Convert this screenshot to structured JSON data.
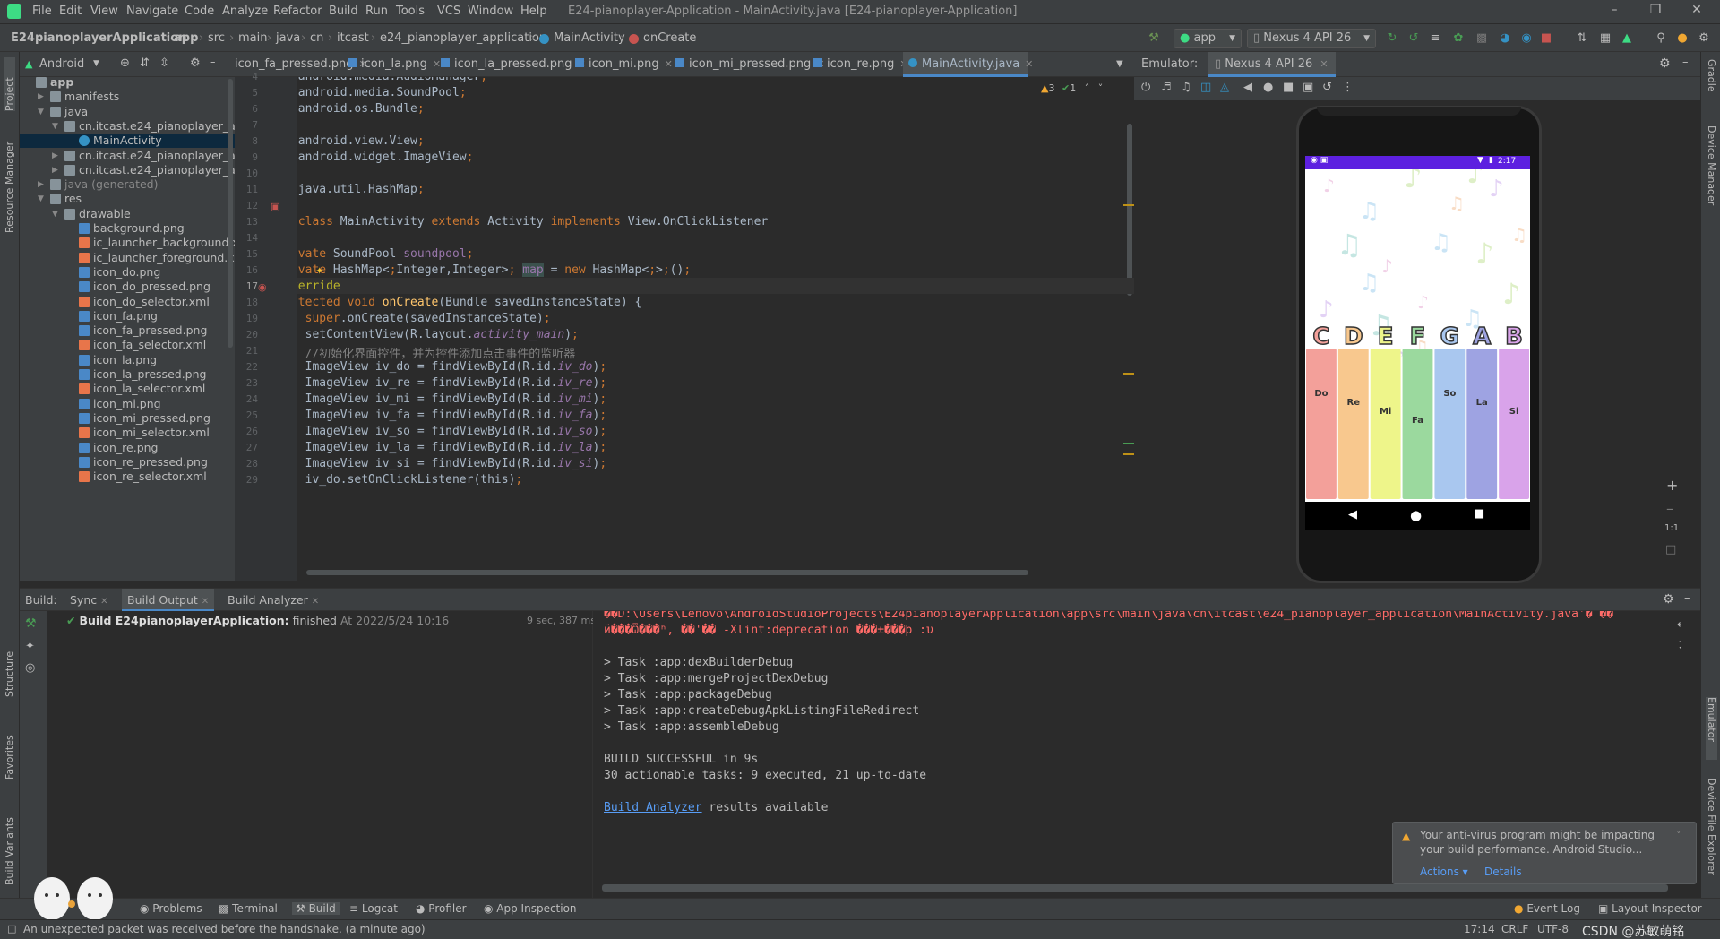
{
  "menu": {
    "items": [
      "File",
      "Edit",
      "View",
      "Navigate",
      "Code",
      "Analyze",
      "Refactor",
      "Build",
      "Run",
      "Tools",
      "VCS",
      "Window",
      "Help"
    ],
    "window_title": "E24-pianoplayer-Application - MainActivity.java [E24-pianoplayer-Application]"
  },
  "breadcrumb": [
    "E24pianoplayerApplication",
    "app",
    "src",
    "main",
    "java",
    "cn",
    "itcast",
    "e24_pianoplayer_application",
    "MainActivity",
    "onCreate"
  ],
  "run_config": {
    "module": "app",
    "device": "Nexus 4 API 26"
  },
  "project_panel": {
    "view_label": "Android",
    "tree": [
      {
        "label": "app",
        "level": 0
      },
      {
        "label": "manifests",
        "level": 1
      },
      {
        "label": "java",
        "level": 1
      },
      {
        "label": "cn.itcast.e24_pianoplayer_applic",
        "level": 2
      },
      {
        "label": "MainActivity",
        "level": 3
      },
      {
        "label": "cn.itcast.e24_pianoplayer_applic",
        "level": 2
      },
      {
        "label": "cn.itcast.e24_pianoplayer_applic",
        "level": 2
      },
      {
        "label": "java (generated)",
        "level": 1
      },
      {
        "label": "res",
        "level": 1
      },
      {
        "label": "drawable",
        "level": 2
      },
      {
        "label": "background.png",
        "level": 3
      },
      {
        "label": "ic_launcher_background.xml",
        "level": 3
      },
      {
        "label": "ic_launcher_foreground.xml",
        "level": 3
      },
      {
        "label": "icon_do.png",
        "level": 3
      },
      {
        "label": "icon_do_pressed.png",
        "level": 3
      },
      {
        "label": "icon_do_selector.xml",
        "level": 3
      },
      {
        "label": "icon_fa.png",
        "level": 3
      },
      {
        "label": "icon_fa_pressed.png",
        "level": 3
      },
      {
        "label": "icon_fa_selector.xml",
        "level": 3
      },
      {
        "label": "icon_la.png",
        "level": 3
      },
      {
        "label": "icon_la_pressed.png",
        "level": 3
      },
      {
        "label": "icon_la_selector.xml",
        "level": 3
      },
      {
        "label": "icon_mi.png",
        "level": 3
      },
      {
        "label": "icon_mi_pressed.png",
        "level": 3
      },
      {
        "label": "icon_mi_selector.xml",
        "level": 3
      },
      {
        "label": "icon_re.png",
        "level": 3
      },
      {
        "label": "icon_re_pressed.png",
        "level": 3
      },
      {
        "label": "icon_re_selector.xml",
        "level": 3
      }
    ]
  },
  "editor_tabs": [
    "icon_fa_pressed.png",
    "icon_la.png",
    "icon_la_pressed.png",
    "icon_mi.png",
    "icon_mi_pressed.png",
    "icon_re.png",
    "MainActivity.java"
  ],
  "inspections": {
    "warnings": "3",
    "ok": "1"
  },
  "code_lines": [
    {
      "n": "4",
      "t": "import android.media.AudioManager;"
    },
    {
      "n": "5",
      "t": "import android.media.SoundPool;"
    },
    {
      "n": "6",
      "t": "import android.os.Bundle;"
    },
    {
      "n": "7",
      "t": ""
    },
    {
      "n": "8",
      "t": "import android.view.View;"
    },
    {
      "n": "9",
      "t": "import android.widget.ImageView;"
    },
    {
      "n": "10",
      "t": ""
    },
    {
      "n": "11",
      "t": "import java.util.HashMap;"
    },
    {
      "n": "12",
      "t": ""
    },
    {
      "n": "13",
      "t": "public class MainActivity extends Activity implements View.OnClickListener"
    },
    {
      "n": "14",
      "t": "{"
    },
    {
      "n": "15",
      "t": "    private SoundPool soundpool;"
    },
    {
      "n": "16",
      "t": "    private HashMap<Integer,Integer> map = new HashMap<>();"
    },
    {
      "n": "17",
      "t": "    @Override"
    },
    {
      "n": "18",
      "t": "    protected void onCreate(Bundle savedInstanceState) {"
    },
    {
      "n": "19",
      "t": "        super.onCreate(savedInstanceState);"
    },
    {
      "n": "20",
      "t": "        setContentView(R.layout.activity_main);"
    },
    {
      "n": "21",
      "t": "        //初始化界面控件，并为控件添加点击事件的监听器"
    },
    {
      "n": "22",
      "t": "        ImageView iv_do = findViewById(R.id.iv_do);"
    },
    {
      "n": "23",
      "t": "        ImageView iv_re = findViewById(R.id.iv_re);"
    },
    {
      "n": "24",
      "t": "        ImageView iv_mi = findViewById(R.id.iv_mi);"
    },
    {
      "n": "25",
      "t": "        ImageView iv_fa = findViewById(R.id.iv_fa);"
    },
    {
      "n": "26",
      "t": "        ImageView iv_so = findViewById(R.id.iv_so);"
    },
    {
      "n": "27",
      "t": "        ImageView iv_la = findViewById(R.id.iv_la);"
    },
    {
      "n": "28",
      "t": "        ImageView iv_si = findViewById(R.id.iv_si);"
    },
    {
      "n": "29",
      "t": "        iv_do.setOnClickListener(this);"
    }
  ],
  "emulator": {
    "label": "Emulator:",
    "device_tab": "Nexus 4 API 26",
    "status_time": "2:17",
    "letters": [
      "C",
      "D",
      "E",
      "F",
      "G",
      "A",
      "B"
    ],
    "keys": [
      "Do",
      "Re",
      "Mi",
      "Fa",
      "So",
      "La",
      "Si"
    ],
    "key_colors": [
      "#f3a09a",
      "#f8c88e",
      "#eef58a",
      "#9bd99e",
      "#a9c7ef",
      "#9ea3e2",
      "#d9a3ea"
    ],
    "zoom_label": "1:1"
  },
  "bottom": {
    "tabs_label": "Build:",
    "tabs": [
      "Sync",
      "Build Output",
      "Build Analyzer"
    ],
    "build_title": "Build E24pianoplayerApplication:",
    "build_status": "finished",
    "build_time": "At 2022/5/24 10:16",
    "build_duration": "9 sec, 387 ms",
    "output": [
      "��D:\\Users\\Lenovo\\AndroidStudioProjects\\E24pianoplayerApplication\\app\\src\\main\\java\\cn\\itcast\\e24_pianoplayer_application\\MainActivity.java'�ʹ��",
      "й���Ѿ���ʱ, ��'�� -Xlint:deprecation ���±���ϸ :υ",
      "",
      "> Task :app:dexBuilderDebug",
      "> Task :app:mergeProjectDexDebug",
      "> Task :app:packageDebug",
      "> Task :app:createDebugApkListingFileRedirect",
      "> Task :app:assembleDebug",
      "",
      "BUILD SUCCESSFUL in 9s",
      "30 actionable tasks: 9 executed, 21 up-to-date",
      ""
    ],
    "analyzer_link": "Build Analyzer",
    "analyzer_tail": " results available"
  },
  "notification": {
    "text": "Your anti-virus program might be impacting your build performance. Android Studio...",
    "actions": "Actions",
    "details": "Details"
  },
  "tool_windows": [
    "Problems",
    "Terminal",
    "Build",
    "Logcat",
    "Profiler",
    "App Inspection"
  ],
  "tool_windows_right": [
    "Event Log",
    "Layout Inspector"
  ],
  "left_stripe": [
    "Project",
    "Resource Manager",
    "Structure",
    "Favorites",
    "Build Variants"
  ],
  "right_stripe": [
    "Gradle",
    "Device Manager",
    "Emulator",
    "Device File Explorer"
  ],
  "status": {
    "message": "An unexpected packet was received before the handshake. (a minute ago)",
    "position": "17:14",
    "line_sep": "CRLF",
    "encoding": "UTF-8",
    "watermark": "CSDN @苏敏萌铭"
  },
  "colors": {
    "accent": "#4a88c7",
    "error": "#ff6b68",
    "success": "#499c54",
    "phone_status": "#5d20e0"
  }
}
